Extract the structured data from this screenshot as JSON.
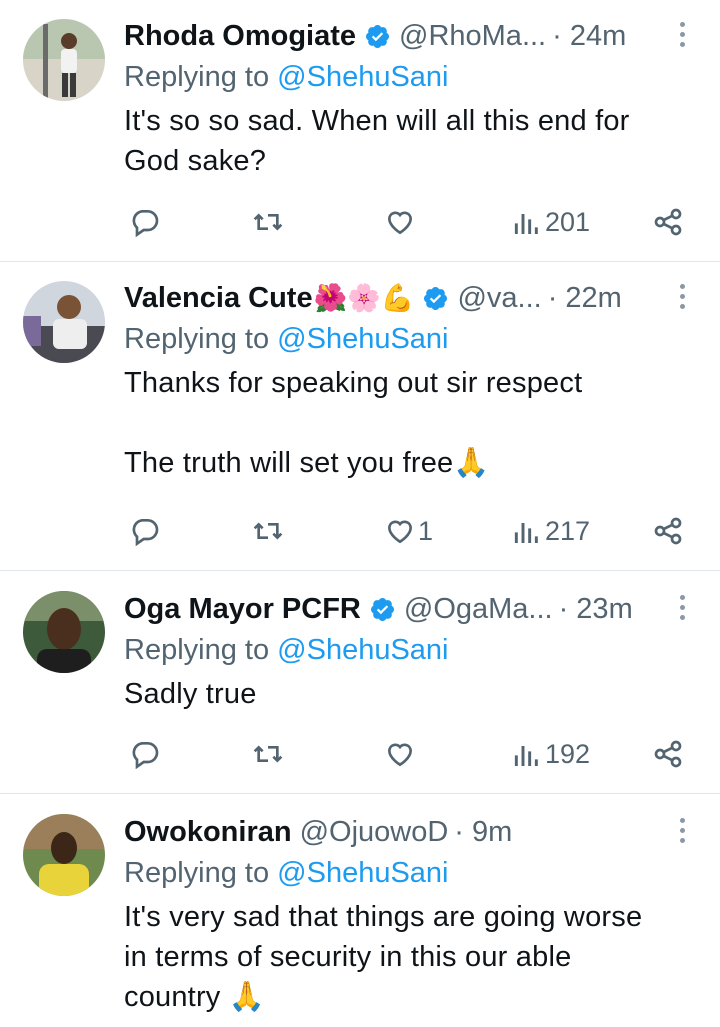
{
  "tweets": [
    {
      "name": "Rhoda Omogiate",
      "emoji": "",
      "verified": true,
      "handle": "@RhoMa...",
      "time": "· 24m",
      "replying_prefix": "Replying to ",
      "replying_to": "@ShehuSani",
      "text": "It's so so sad. When will all this end for\nGod sake?",
      "likes": "",
      "views": "201"
    },
    {
      "name": "Valencia Cute",
      "emoji": "🌺🌸💪",
      "verified": true,
      "handle": "@va...",
      "time": "· 22m",
      "replying_prefix": "Replying to ",
      "replying_to": "@ShehuSani",
      "text": "Thanks for speaking out sir respect\n\nThe truth will set you free🙏",
      "likes": "1",
      "views": "217"
    },
    {
      "name": "Oga Mayor PCFR",
      "emoji": "",
      "verified": true,
      "handle": "@OgaMa...",
      "time": "· 23m",
      "replying_prefix": "Replying to ",
      "replying_to": "@ShehuSani",
      "text": "Sadly true",
      "likes": "",
      "views": "192"
    },
    {
      "name": "Owokoniran",
      "emoji": "",
      "verified": false,
      "handle": "@OjuowoD",
      "time": "· 9m",
      "replying_prefix": "Replying to ",
      "replying_to": "@ShehuSani",
      "text": "It's very sad that things are going worse\nin terms of security in this our able\ncountry 🙏",
      "likes": "",
      "views": ""
    }
  ],
  "icons": {
    "reply": "reply-icon",
    "retweet": "retweet-icon",
    "like": "heart-icon",
    "views": "views-icon",
    "share": "share-icon",
    "verified": "verified-badge-icon",
    "more": "more-icon"
  },
  "colors": {
    "link": "#1d9bf0",
    "muted": "#536471",
    "text": "#0f1419",
    "divider": "#e1e6ea"
  }
}
